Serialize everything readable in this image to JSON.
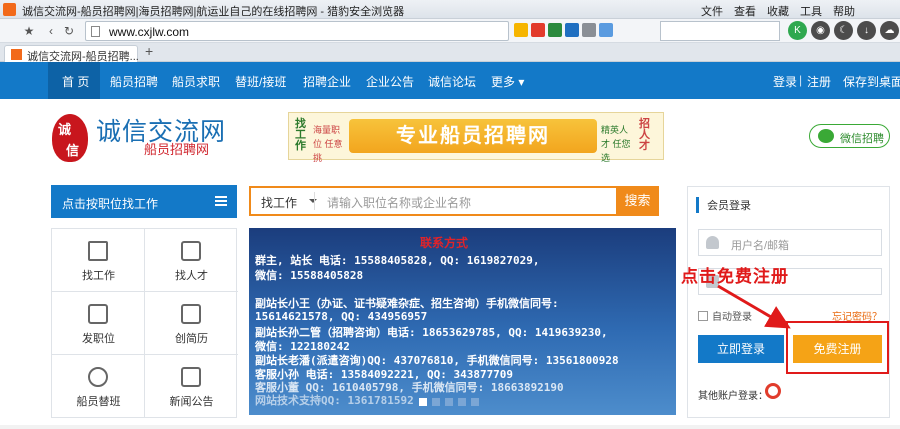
{
  "browser": {
    "window_title": "诚信交流网-船员招聘网|海员招聘网|航运业自己的在线招聘网 - 猎豹安全浏览器",
    "menus": [
      "文件(F)",
      "查看(V)",
      "收藏(B)",
      "工具(T)",
      "帮助"
    ],
    "url": "www.cxjlw.com",
    "tab_title": "诚信交流网-船员招聘...",
    "new_tab": "+"
  },
  "site": {
    "nav": {
      "items": [
        "首 页",
        "船员招聘",
        "船员求职",
        "替班/接班",
        "招聘企业",
        "企业公告",
        "诚信论坛",
        "更多"
      ],
      "more_arrow": "▾",
      "login": "登录",
      "sep": "|",
      "register": "注册",
      "save_desktop": "保存到桌面"
    },
    "logo": {
      "seal_chars": [
        "诚",
        "信"
      ],
      "name": "诚信交流网",
      "sub": "船员招聘网"
    },
    "banner": {
      "main": "专业船员招聘网",
      "left_big": "找工作",
      "left_small": "海量职位 任意挑",
      "right_small": "精英人才 任您选",
      "right_big": "招人才"
    },
    "wechat": "微信招聘",
    "category": {
      "title": "点击按职位找工作",
      "items": [
        "找工作",
        "找人才",
        "发职位",
        "创简历",
        "船员替班",
        "新闻公告"
      ]
    },
    "search": {
      "select": "找工作",
      "placeholder": "请输入职位名称或企业名称",
      "button": "搜索"
    },
    "slide": {
      "heading": "联系方式",
      "lines": [
        "群主, 站长 电话: 15588405828, QQ: 1619827029,",
        "微信: 15588405828",
        "",
        "副站长小王（办证、证书疑难杂症、招生咨询）手机微信同号:",
        "15614621578, QQ: 434956957",
        "副站长孙二管（招聘咨询）电话: 18653629785, QQ: 1419639230,",
        "微信: 122180242",
        "副站长老潘(派遣咨询)QQ: 437076810, 手机微信同号: 13561800928",
        "客服小孙  电话: 13584092221, QQ: 343877709",
        "客服小董 QQ: 1610405798, 手机微信同号: 18663892190",
        "网站技术支持QQ: 1361781592"
      ],
      "dot_count": 5,
      "active_dot": 0
    },
    "login": {
      "title": "会员登录",
      "username_placeholder": "用户名/邮箱",
      "auto_login": "自动登录",
      "forgot": "忘记密码？",
      "login_button": "立即登录",
      "register_button": "免费注册",
      "other_login": "其他账户登录："
    }
  },
  "annotation": {
    "text": "点击免费注册",
    "color": "#e01a1a"
  },
  "colors": {
    "nav_blue": "#1379c8",
    "orange": "#f08a1a",
    "register_orange": "#f5a316"
  }
}
